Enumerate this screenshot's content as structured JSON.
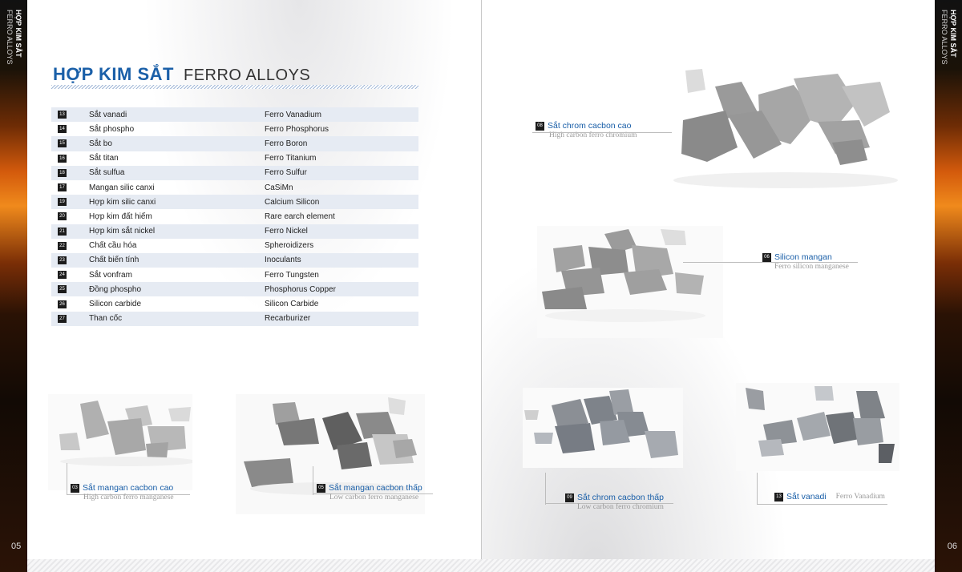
{
  "side": {
    "line1": "HỢP KIM SẮT",
    "line2": "FERRO ALLOYS"
  },
  "pages": {
    "left": "05",
    "right": "06"
  },
  "heading": {
    "vn": "HỢP KIM SẮT",
    "en": "FERRO ALLOYS"
  },
  "table": [
    {
      "num": "13",
      "vn": "Sắt vanadi",
      "en": "Ferro Vanadium"
    },
    {
      "num": "14",
      "vn": "Sắt phospho",
      "en": "Ferro Phosphorus"
    },
    {
      "num": "15",
      "vn": "Sắt bo",
      "en": "Ferro Boron"
    },
    {
      "num": "16",
      "vn": "Sắt titan",
      "en": "Ferro Titanium"
    },
    {
      "num": "18",
      "vn": "Sắt sulfua",
      "en": "Ferro Sulfur"
    },
    {
      "num": "17",
      "vn": "Mangan silic canxi",
      "en": "CaSiMn"
    },
    {
      "num": "19",
      "vn": "Hợp kim silic canxi",
      "en": "Calcium Silicon"
    },
    {
      "num": "20",
      "vn": "Hợp kim đất hiếm",
      "en": "Rare earch element"
    },
    {
      "num": "21",
      "vn": "Hợp kim sắt nickel",
      "en": "Ferro Nickel"
    },
    {
      "num": "22",
      "vn": "Chất cầu hóa",
      "en": "Spheroidizers"
    },
    {
      "num": "23",
      "vn": "Chất biến tính",
      "en": "Inoculants"
    },
    {
      "num": "24",
      "vn": "Sắt vonfram",
      "en": "Ferro Tungsten"
    },
    {
      "num": "25",
      "vn": "Đồng phospho",
      "en": "Phosphorus Copper"
    },
    {
      "num": "26",
      "vn": "Silicon carbide",
      "en": "Silicon Carbide"
    },
    {
      "num": "27",
      "vn": "Than cốc",
      "en": "Recarburizer"
    }
  ],
  "products": {
    "p08": {
      "num": "08",
      "title": "Sắt chrom cacbon cao",
      "sub": "High carbon ferro chromium"
    },
    "p06": {
      "num": "06",
      "title": "Silicon mangan",
      "sub": "Ferro silicon manganese"
    },
    "p03": {
      "num": "03",
      "title": "Sắt mangan cacbon cao",
      "sub": "High carbon ferro manganese"
    },
    "p05": {
      "num": "05",
      "title": "Sắt mangan cacbon thấp",
      "sub": "Low carbon ferro manganese"
    },
    "p09": {
      "num": "09",
      "title": "Sắt chrom cacbon thấp",
      "sub": "Low carbon ferro chromium"
    },
    "p13": {
      "num": "13",
      "title": "Sắt vanadi",
      "sub": "Ferro Vanadium"
    }
  }
}
